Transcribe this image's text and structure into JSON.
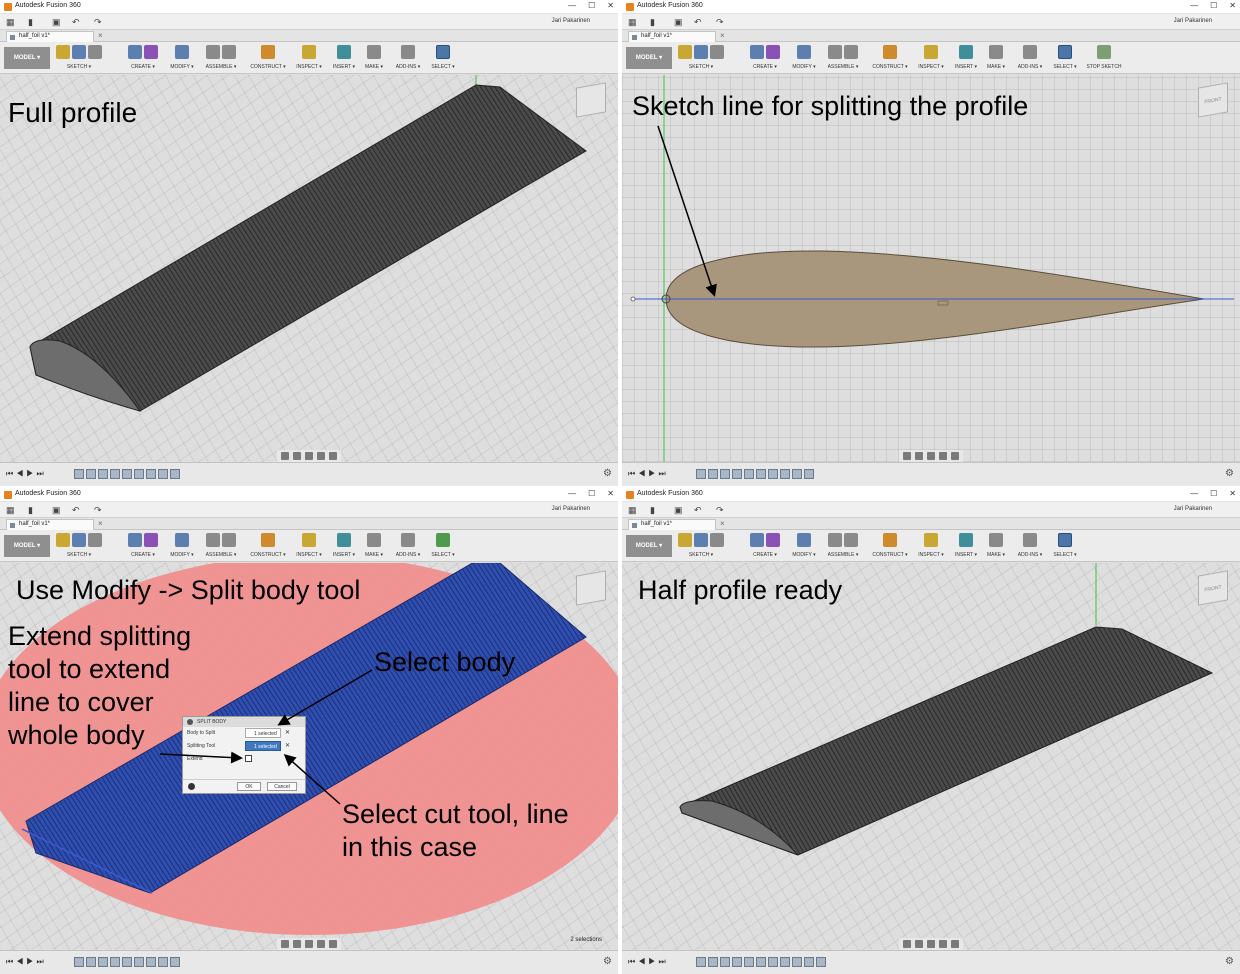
{
  "app_title": "Autodesk Fusion 360",
  "window_controls": [
    "—",
    "☐",
    "✕"
  ],
  "user_name": "Jari Pakarinen",
  "doc_tab": "half_foil v1*",
  "model_button": "MODEL ▾",
  "ribbon": {
    "sketch": "SKETCH ▾",
    "create": "CREATE ▾",
    "modify": "MODIFY ▾",
    "assemble": "ASSEMBLE ▾",
    "construct": "CONSTRUCT ▾",
    "inspect": "INSPECT ▾",
    "insert": "INSERT ▾",
    "make": "MAKE ▾",
    "addins": "ADD-INS ▾",
    "select": "SELECT ▾",
    "stop_sketch": "STOP SKETCH"
  },
  "viewcube": {
    "front": "FRONT"
  },
  "annotations": {
    "p1_label": "Full profile",
    "p2_label": "Sketch line for splitting the profile",
    "p3_label": "Use Modify -> Split body tool",
    "p3_extend": "Extend splitting\ntool to extend\nline to cover\nwhole body",
    "p3_select_body": "Select body",
    "p3_select_cut": "Select cut tool, line\nin this case",
    "p4_label": "Half profile ready"
  },
  "split_dialog": {
    "title": "SPLIT BODY",
    "body_to_split_label": "Body to Split",
    "body_to_split_value": "1 selected",
    "splitting_tool_label": "Splitting Tool",
    "splitting_tool_value": "1 selected",
    "extend_label": "Extend",
    "ok": "OK",
    "cancel": "Cancel"
  },
  "status": {
    "selections": "2 selections"
  },
  "colors": {
    "body_dark": "#4a4a4a",
    "profile_tan": "#a9977d",
    "split_plane": "#ef8e8e",
    "selected_body": "#2f4fb0"
  }
}
